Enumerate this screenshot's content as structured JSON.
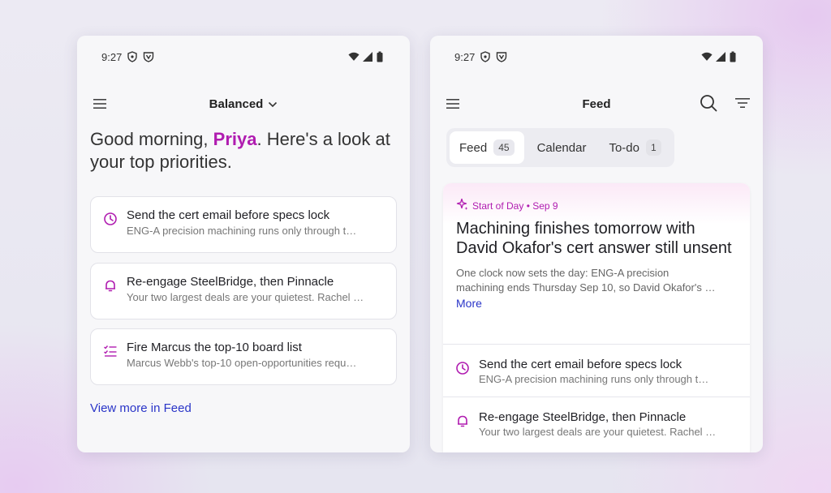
{
  "accent": "#b01cb0",
  "link_color": "#2a35c8",
  "left_phone": {
    "status": {
      "time": "9:27",
      "icons": [
        "shield-icon",
        "vpn-icon",
        "wifi-icon",
        "signal-icon",
        "battery-icon"
      ]
    },
    "appbar": {
      "title": "Balanced",
      "menu_icon": "hamburger-menu-icon",
      "dropdown_icon": "chevron-down-icon"
    },
    "greeting": {
      "prefix": "Good morning, ",
      "name": "Priya",
      "suffix": ". Here's a look at your top priorities."
    },
    "cards": [
      {
        "icon": "clock-icon",
        "title": "Send the cert email before specs lock",
        "subtitle": "ENG-A precision machining runs only through t…"
      },
      {
        "icon": "bell-icon",
        "title": "Re-engage SteelBridge, then Pinnacle",
        "subtitle": "Your two largest deals are your quietest. Rachel …"
      },
      {
        "icon": "checklist-icon",
        "title": "Fire Marcus the top-10 board list",
        "subtitle": "Marcus Webb's top-10 open-opportunities requ…"
      }
    ],
    "view_more": "View more in Feed"
  },
  "right_phone": {
    "status": {
      "time": "9:27",
      "icons": [
        "shield-icon",
        "vpn-icon",
        "wifi-icon",
        "signal-icon",
        "battery-icon"
      ]
    },
    "appbar": {
      "title": "Feed",
      "menu_icon": "hamburger-menu-icon",
      "search_icon": "search-icon",
      "filter_icon": "filter-icon"
    },
    "tabs": [
      {
        "label": "Feed",
        "count": "45",
        "active": true
      },
      {
        "label": "Calendar",
        "count": "",
        "active": false
      },
      {
        "label": "To-do",
        "count": "1",
        "active": false
      }
    ],
    "start_of_day": {
      "label": "Start of Day • Sep 9",
      "headline": "Machining finishes tomorrow with David Okafor's cert answer still unsent",
      "summary_line1": "One clock now sets the day: ENG-A precision",
      "summary_line2": "machining ends Thursday Sep 10, so David Okafor's …",
      "more": "More"
    },
    "items": [
      {
        "icon": "clock-icon",
        "title": "Send the cert email before specs lock",
        "subtitle": "ENG-A precision machining runs only through t…"
      },
      {
        "icon": "bell-icon",
        "title": "Re-engage SteelBridge, then Pinnacle",
        "subtitle": "Your two largest deals are your quietest. Rachel …"
      }
    ]
  }
}
